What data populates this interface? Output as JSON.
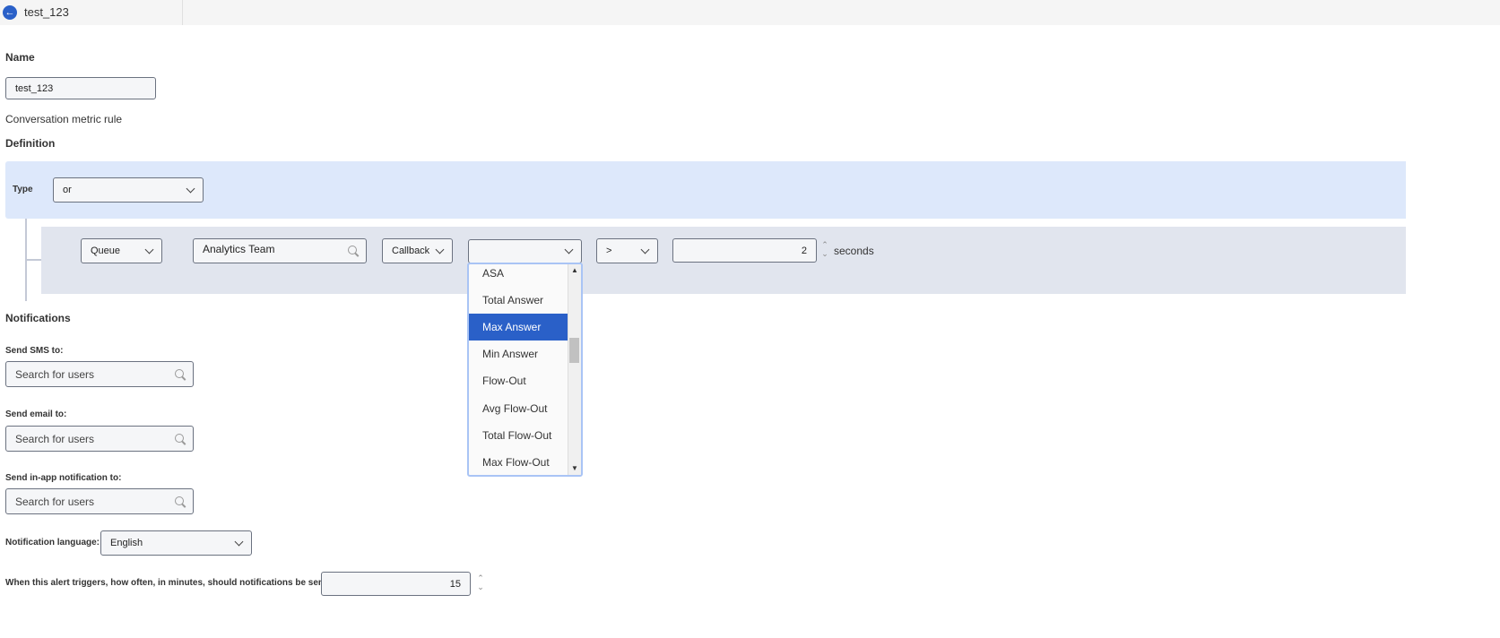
{
  "header": {
    "title": "test_123",
    "back_icon": "arrow-left-icon"
  },
  "name": {
    "label": "Name",
    "value": "test_123"
  },
  "rule_type_text": "Conversation metric rule",
  "definition": {
    "label": "Definition",
    "type_label": "Type",
    "type_value": "or",
    "condition": {
      "entity": "Queue",
      "queue_search": "Analytics Team",
      "media": "Callback",
      "metric": "",
      "operator": ">",
      "value": "2",
      "unit": "seconds"
    },
    "metric_options": [
      "ASA",
      "Total Answer",
      "Max Answer",
      "Min Answer",
      "Flow-Out",
      "Avg Flow-Out",
      "Total Flow-Out",
      "Max Flow-Out"
    ],
    "highlighted_option": "Max Answer"
  },
  "notifications": {
    "label": "Notifications",
    "sms": {
      "label": "Send SMS to:",
      "placeholder": "Search for users"
    },
    "email": {
      "label": "Send email to:",
      "placeholder": "Search for users"
    },
    "inapp": {
      "label": "Send in-app notification to:",
      "placeholder": "Search for users"
    },
    "language": {
      "label": "Notification language:",
      "value": "English"
    },
    "frequency": {
      "label": "When this alert triggers, how often, in minutes, should notifications be sent?",
      "value": "15"
    }
  },
  "colors": {
    "accent": "#2a60c8",
    "type_band": "#dde8fb",
    "condition_band": "#e1e5ee"
  }
}
